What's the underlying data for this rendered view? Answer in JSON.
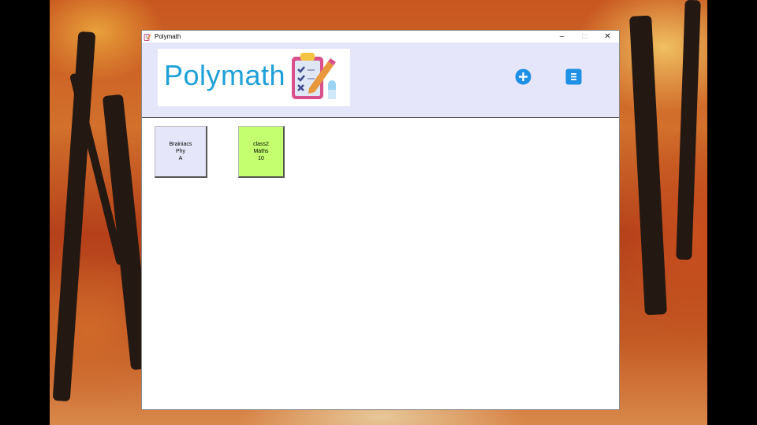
{
  "window": {
    "title": "Polymath",
    "controls": {
      "minimize": "–",
      "restore": "□",
      "close": "✕"
    }
  },
  "header": {
    "logo_text": "Polymath",
    "logo_icon": "clipboard-checklist-pencil-icon",
    "add_button_icon": "plus-circle-icon",
    "menu_button_icon": "menu-list-icon",
    "accent_color": "#1e90e6",
    "background_color": "#e6e6fa"
  },
  "classes": [
    {
      "name": "Brainiacs",
      "subject": "Phy",
      "section": "A",
      "color": "#e6e6fa"
    },
    {
      "name": "class2",
      "subject": "Maths",
      "section": "10",
      "color": "#c3ff6e"
    }
  ]
}
